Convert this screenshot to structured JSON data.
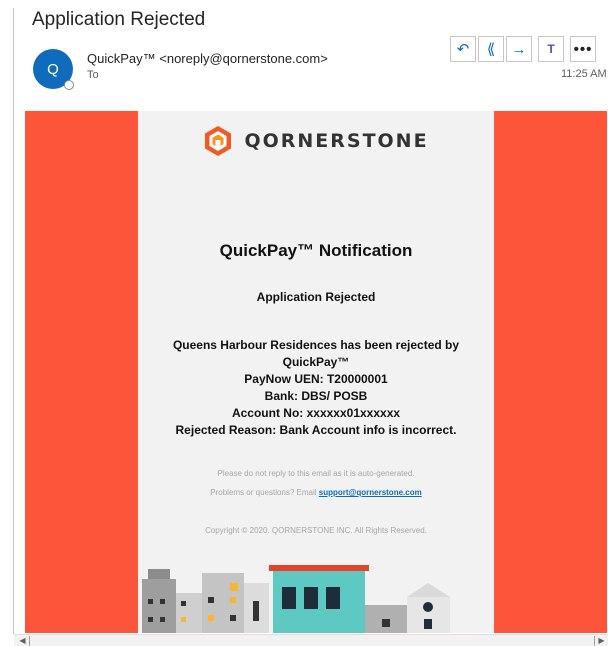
{
  "header": {
    "subject": "Application Rejected",
    "avatar_initial": "Q",
    "sender": "QuickPay™ <noreply@qornerstone.com>",
    "to_label": "To",
    "time": "11:25 AM"
  },
  "actions": [
    {
      "name": "reply",
      "glyph": "↶"
    },
    {
      "name": "reply-all",
      "glyph": "⟪"
    },
    {
      "name": "forward",
      "glyph": "→"
    },
    {
      "name": "teams",
      "glyph": "T"
    },
    {
      "name": "more",
      "glyph": "•••"
    }
  ],
  "email": {
    "logo_text": "QORNERSTONE",
    "notification_title": "QuickPay™ Notification",
    "status": "Application Rejected",
    "body_lines": [
      "Queens Harbour Residences has been rejected by",
      "QuickPay™",
      "PayNow UEN: T20000001",
      "Bank: DBS/ POSB",
      "Account No: xxxxxx01xxxxxx",
      "Rejected Reason: Bank Account info is incorrect."
    ],
    "footer_note": "Please do not reply to this email as it is auto-generated.",
    "footer_question": "Problems or questions? Email ",
    "support_email": "support@qornerstone.com",
    "copyright": "Copyright © 2020. QORNERSTONE INC. All Rights Reserved."
  },
  "colors": {
    "banner": "#fd5539",
    "card": "#f2f2f2",
    "accent": "#0f6cbd",
    "logo_orange": "#f15a24"
  },
  "icons": [
    "reply-icon",
    "reply-all-icon",
    "forward-icon",
    "teams-icon",
    "more-icon",
    "qornerstone-logo-icon"
  ]
}
